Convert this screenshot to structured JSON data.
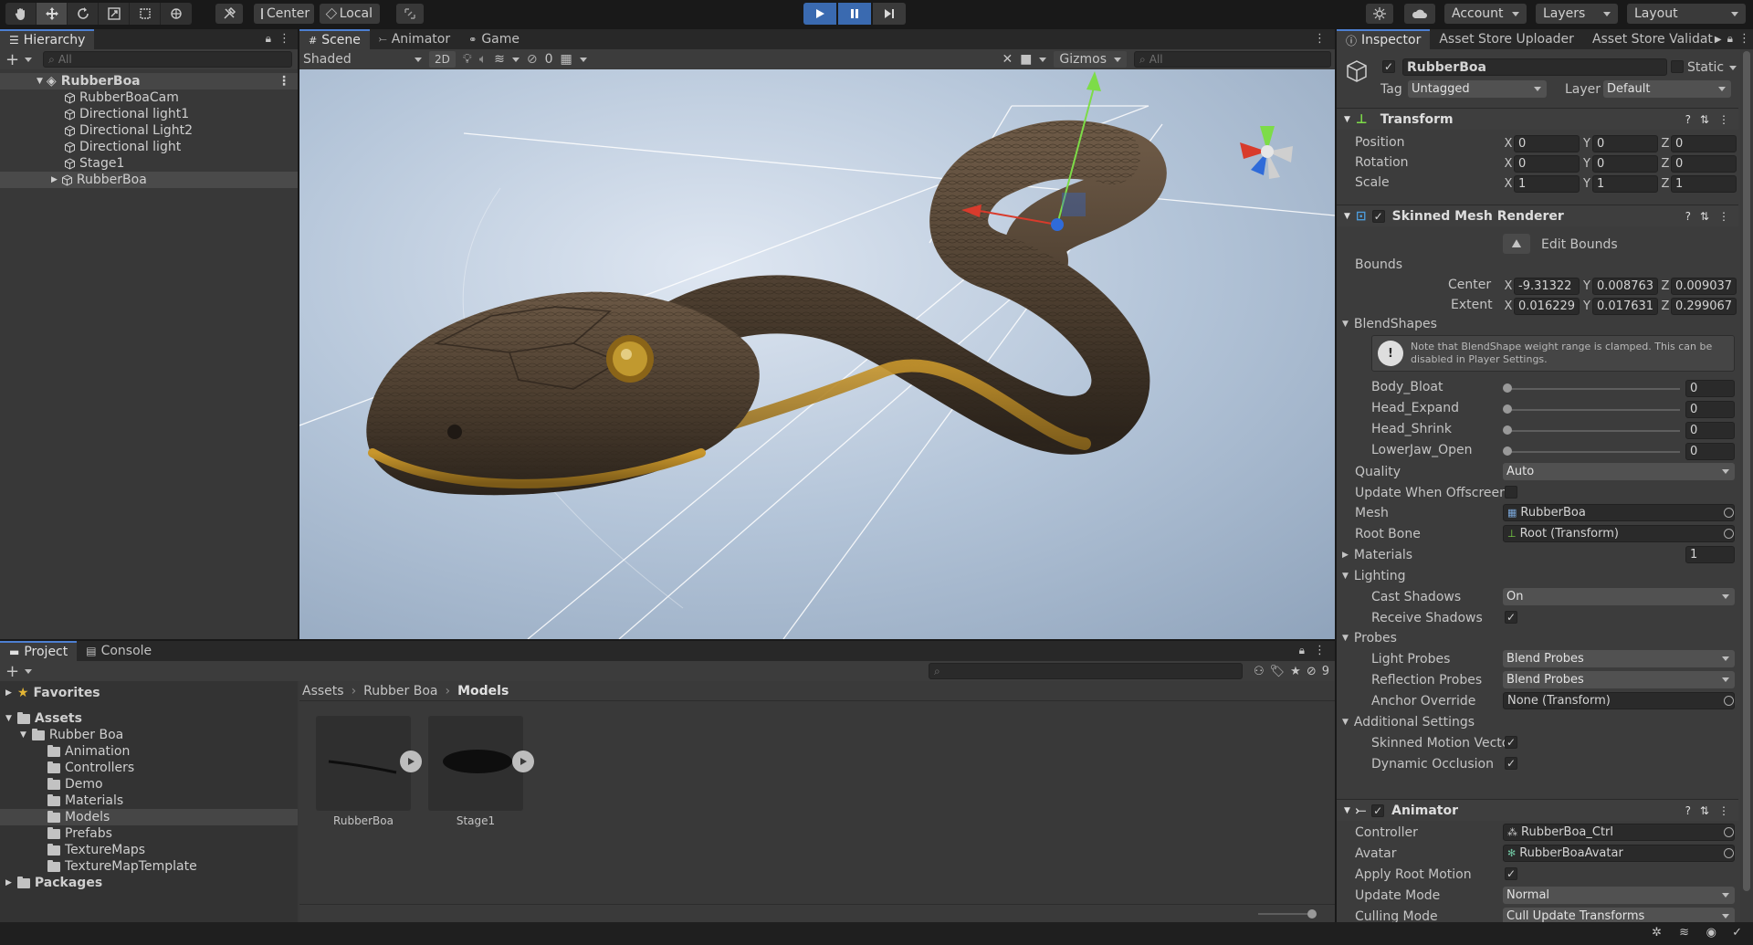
{
  "toolbar": {
    "pivot_center": "Center",
    "pivot_local": "Local",
    "account": "Account",
    "layers": "Layers",
    "layout": "Layout"
  },
  "hierarchy": {
    "tab": "Hierarchy",
    "search_placeholder": "All",
    "scene": "RubberBoa",
    "items": [
      "RubberBoaCam",
      "Directional light1",
      "Directional Light2",
      "Directional light",
      "Stage1",
      "RubberBoa"
    ]
  },
  "scene_view": {
    "tabs": [
      "Scene",
      "Animator",
      "Game"
    ],
    "shading": "Shaded",
    "mode_2d": "2D",
    "hidden_count": "0",
    "gizmos": "Gizmos",
    "search_placeholder": "All"
  },
  "project": {
    "tabs": [
      "Project",
      "Console"
    ],
    "favorites": "Favorites",
    "assets": "Assets",
    "rubber_boa": "Rubber Boa",
    "folders": [
      "Animation",
      "Controllers",
      "Demo",
      "Materials",
      "Models",
      "Prefabs",
      "TextureMaps",
      "TextureMapTemplate"
    ],
    "packages": "Packages",
    "breadcrumb": [
      "Assets",
      "Rubber Boa",
      "Models"
    ],
    "hidden_count": "9",
    "thumbnails": [
      "RubberBoa",
      "Stage1"
    ]
  },
  "inspector": {
    "tabs": [
      "Inspector",
      "Asset Store Uploader",
      "Asset Store Validat"
    ],
    "object_name": "RubberBoa",
    "static_label": "Static",
    "tag_label": "Tag",
    "tag_value": "Untagged",
    "layer_label": "Layer",
    "layer_value": "Default",
    "transform": {
      "title": "Transform",
      "rows": [
        {
          "label": "Position",
          "x": "0",
          "y": "0",
          "z": "0"
        },
        {
          "label": "Rotation",
          "x": "0",
          "y": "0",
          "z": "0"
        },
        {
          "label": "Scale",
          "x": "1",
          "y": "1",
          "z": "1"
        }
      ]
    },
    "smr": {
      "title": "Skinned Mesh Renderer",
      "edit_bounds": "Edit Bounds",
      "bounds": "Bounds",
      "center_label": "Center",
      "center": {
        "x": "-9.31322",
        "y": "0.008763",
        "z": "0.009037"
      },
      "extent_label": "Extent",
      "extent": {
        "x": "0.016229",
        "y": "0.017631",
        "z": "0.299067"
      },
      "blendshapes": "BlendShapes",
      "note": "Note that BlendShape weight range is clamped. This can be disabled in Player Settings.",
      "shapes": [
        {
          "name": "Body_Bloat",
          "value": "0"
        },
        {
          "name": "Head_Expand",
          "value": "0"
        },
        {
          "name": "Head_Shrink",
          "value": "0"
        },
        {
          "name": "LowerJaw_Open",
          "value": "0"
        }
      ],
      "quality_label": "Quality",
      "quality": "Auto",
      "update_offscreen": "Update When Offscreen",
      "mesh_label": "Mesh",
      "mesh": "RubberBoa",
      "root_bone_label": "Root Bone",
      "root_bone": "Root (Transform)",
      "materials": "Materials",
      "materials_count": "1",
      "lighting": "Lighting",
      "cast_shadows_label": "Cast Shadows",
      "cast_shadows": "On",
      "receive_shadows": "Receive Shadows",
      "probes": "Probes",
      "light_probes_label": "Light Probes",
      "light_probes": "Blend Probes",
      "reflection_probes_label": "Reflection Probes",
      "reflection_probes": "Blend Probes",
      "anchor_label": "Anchor Override",
      "anchor": "None (Transform)",
      "additional": "Additional Settings",
      "skinned_motion": "Skinned Motion Vecto",
      "dynamic_occlusion": "Dynamic Occlusion"
    },
    "animator": {
      "title": "Animator",
      "controller_label": "Controller",
      "controller": "RubberBoa_Ctrl",
      "avatar_label": "Avatar",
      "avatar": "RubberBoaAvatar",
      "apply_root_motion": "Apply Root Motion",
      "update_mode_label": "Update Mode",
      "update_mode": "Normal",
      "culling_label": "Culling Mode",
      "culling": "Cull Update Transforms"
    }
  },
  "colors": {
    "accent": "#4d7fd1",
    "play_active": "#3a6ab0",
    "selection": "#464646"
  }
}
